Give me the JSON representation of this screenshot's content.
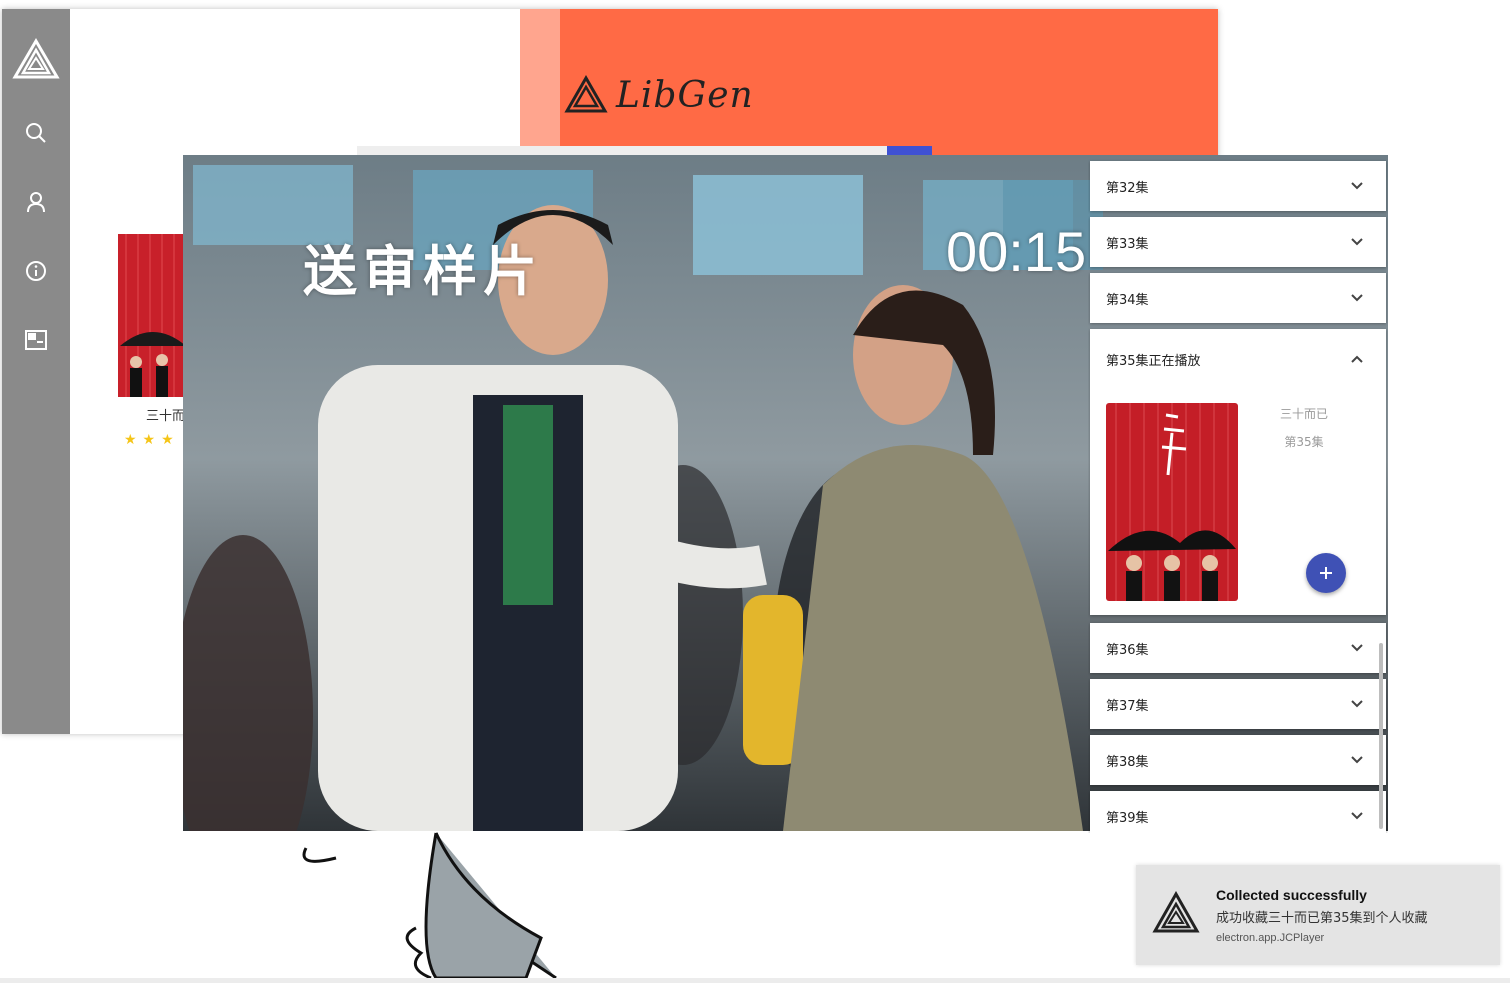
{
  "background_app": {
    "brand_name": "LibGen",
    "card_title": "三十而",
    "card_stars": "★★★",
    "colors": {
      "sidebar": "#8a8a8a",
      "hero": "#ff6a45",
      "accent": "#3f51d3"
    },
    "sidebar_icons": [
      "logo-icon",
      "search-icon",
      "user-icon",
      "info-icon",
      "picture-in-picture-icon"
    ]
  },
  "video": {
    "watermark": "送审样片",
    "timecode": "00:15"
  },
  "episodes": {
    "items_before": [
      {
        "label": "第32集"
      },
      {
        "label": "第33集"
      },
      {
        "label": "第34集"
      }
    ],
    "current": {
      "label": "第35集正在播放",
      "show_title": "三十而已",
      "episode": "第35集",
      "add_icon": "plus-icon"
    },
    "items_after": [
      {
        "label": "第36集"
      },
      {
        "label": "第37集"
      },
      {
        "label": "第38集"
      },
      {
        "label": "第39集"
      }
    ]
  },
  "toast": {
    "title": "Collected successfully",
    "body": "成功收藏三十而已第35集到个人收藏",
    "source": "electron.app.JCPlayer"
  }
}
